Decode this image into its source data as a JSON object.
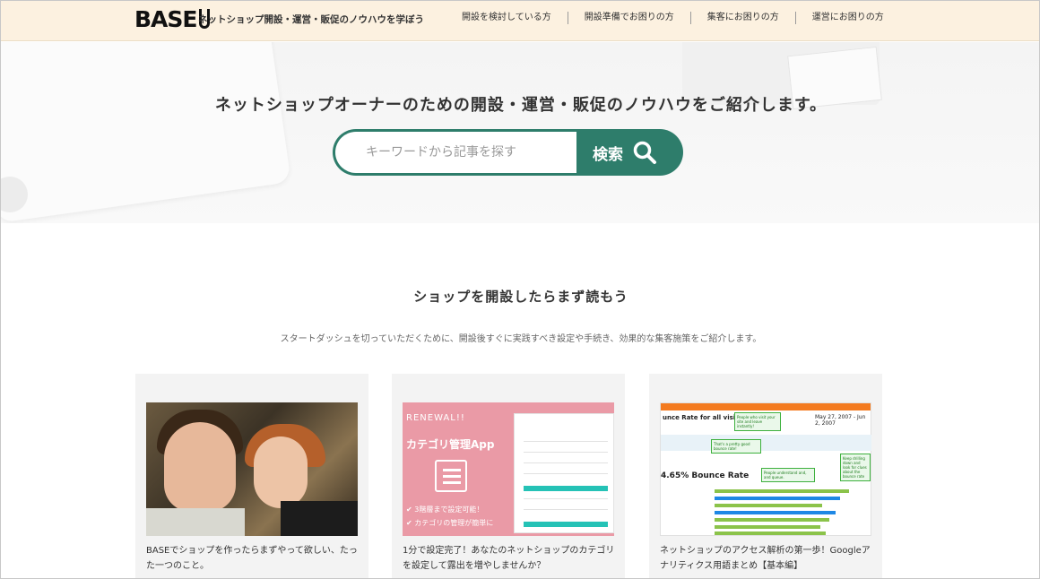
{
  "header": {
    "logo": "BASE",
    "tagline": "ネットショップ開設・運営・販促のノウハウを学ぼう",
    "nav": [
      "開設を検討している方",
      "開設準備でお困りの方",
      "集客にお困りの方",
      "運営にお困りの方"
    ]
  },
  "hero": {
    "title": "ネットショップオーナーのための開設・運営・販促のノウハウをご紹介します。",
    "search_placeholder": "キーワードから記事を探す",
    "search_button": "検索"
  },
  "section": {
    "title": "ショップを開設したらまず読もう",
    "description": "スタートダッシュを切っていただくために、開設後すぐに実践すべき設定や手続き、効果的な集客施策をご紹介します。"
  },
  "cards": [
    {
      "text": "BASEでショップを作ったらまずやって欲しい、たった一つのこと。"
    },
    {
      "text": "1分で設定完了！あなたのネットショップのカテゴリを設定して露出を増やしませんか？",
      "image_labels": {
        "badge": "RENEWAL!!",
        "app_name": "カテゴリ管理App",
        "point1": "✔ 3階層まで設定可能！",
        "point2": "✔ カテゴリの管理が簡単に"
      }
    },
    {
      "text": "ネットショップのアクセス解析の第一歩！Googleアナリティクス用語まとめ【基本編】",
      "image_labels": {
        "title": "unce Rate for all visitors",
        "date_range": "May 27, 2007 - Jun 2, 2007",
        "metric": "4.65% Bounce Rate",
        "note1": "People who visit your site and leave instantly!",
        "note2": "That's a pretty good bounce rate!",
        "note3": "People understand and, and queue.",
        "note4": "Keep drilling down and look for clues about the bounce rate"
      }
    }
  ],
  "colors": {
    "header_bg": "#fcf1e0",
    "accent": "#2e7d6b"
  }
}
